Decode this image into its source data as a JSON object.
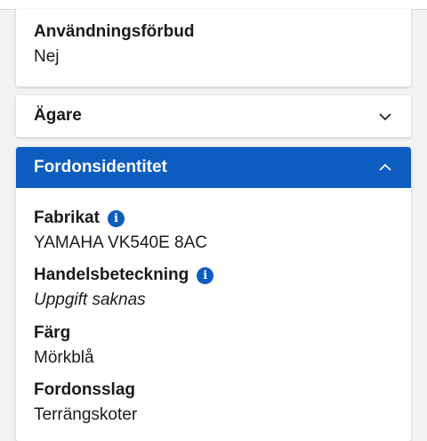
{
  "usage_ban": {
    "label": "Användningsförbud",
    "value": "Nej"
  },
  "owner": {
    "title": "Ägare",
    "icon": "chevron-down-icon"
  },
  "identity": {
    "title": "Fordonsidentitet",
    "icon": "chevron-up-icon",
    "fields": [
      {
        "label": "Fabrikat",
        "value": "YAMAHA VK540E 8AC",
        "info_icon": true
      },
      {
        "label": "Handelsbeteckning",
        "value": "Uppgift saknas",
        "info_icon": true
      },
      {
        "label": "Färg",
        "value": "Mörkblå"
      },
      {
        "label": "Fordonsslag",
        "value": "Terrängskoter"
      }
    ]
  },
  "info_icon_glyph": "i",
  "colors": {
    "accent": "#0d5cc0",
    "background": "#f2f2f2",
    "card": "#ffffff"
  }
}
